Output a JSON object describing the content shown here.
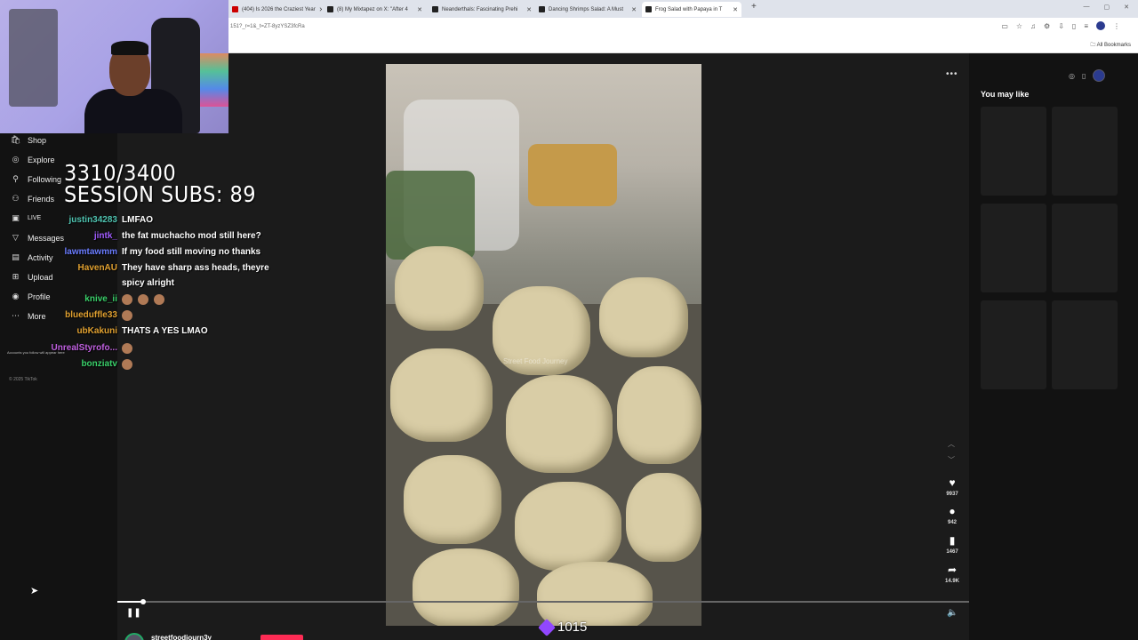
{
  "browser": {
    "tabs": [
      {
        "title": "(404) Is 2026 the Craziest Year"
      },
      {
        "title": "(8) My Mixtapez on X: \"After 4"
      },
      {
        "title": "Neanderthals: Fascinating Prehi"
      },
      {
        "title": "Dancing Shrimps Salad: A Must"
      },
      {
        "title": "Frog Salad with Papaya in T"
      }
    ],
    "new_tab": "+",
    "url": "151?_r=1&_t=ZT-8yzYSZ3fcRa",
    "bookmarks_label": "All Bookmarks"
  },
  "nav": {
    "items": [
      {
        "label": "Shop",
        "icon": "shop-icon"
      },
      {
        "label": "Explore",
        "icon": "compass-icon"
      },
      {
        "label": "Following",
        "icon": "person-icon"
      },
      {
        "label": "Friends",
        "icon": "friends-icon"
      },
      {
        "label": "LIVE",
        "icon": "live-icon"
      },
      {
        "label": "Messages",
        "icon": "message-icon"
      },
      {
        "label": "Activity",
        "icon": "activity-icon"
      },
      {
        "label": "Upload",
        "icon": "upload-icon"
      },
      {
        "label": "Profile",
        "icon": "profile-icon"
      },
      {
        "label": "More",
        "icon": "more-icon"
      }
    ],
    "following_note": "Accounts you follow will appear here",
    "copyright": "© 2025 TikTok"
  },
  "overlay": {
    "counter": "3310/3400",
    "session_subs": "SESSION SUBS: 89"
  },
  "chat": [
    {
      "user": "justin34283",
      "message": "LMFAO",
      "color": "#4fc3b0"
    },
    {
      "user": "jintk_",
      "message": "the fat muchacho mod still here?",
      "color": "#a15cff"
    },
    {
      "user": "lawmtawmm",
      "message": "If my food still moving no thanks",
      "color": "#6a7cff"
    },
    {
      "user": "HavenAU",
      "message": "They have sharp ass heads, theyre",
      "color": "#e0a030"
    },
    {
      "user": "",
      "message": "spicy alright",
      "color": "#ffffff"
    },
    {
      "user": "knive_ii",
      "message": "",
      "color": "#3ad06a"
    },
    {
      "user": "blueduffle33",
      "message": "",
      "color": "#e0a030"
    },
    {
      "user": "ubKakuni",
      "message": "THATS A YES LMAO",
      "color": "#e0a030"
    },
    {
      "user": "UnrealStyrofo...",
      "message": "",
      "color": "#c060e0"
    },
    {
      "user": "bonziatv",
      "message": "",
      "color": "#3ad06a"
    }
  ],
  "video": {
    "watermark": "Street Food Journey"
  },
  "actions": {
    "likes": "9937",
    "comments": "942",
    "saves": "1467",
    "shares": "14.9K"
  },
  "sidebar": {
    "title": "You may like"
  },
  "player": {
    "username": "streetfoodjourn3y",
    "progress": 0.03
  },
  "bits": "1015"
}
